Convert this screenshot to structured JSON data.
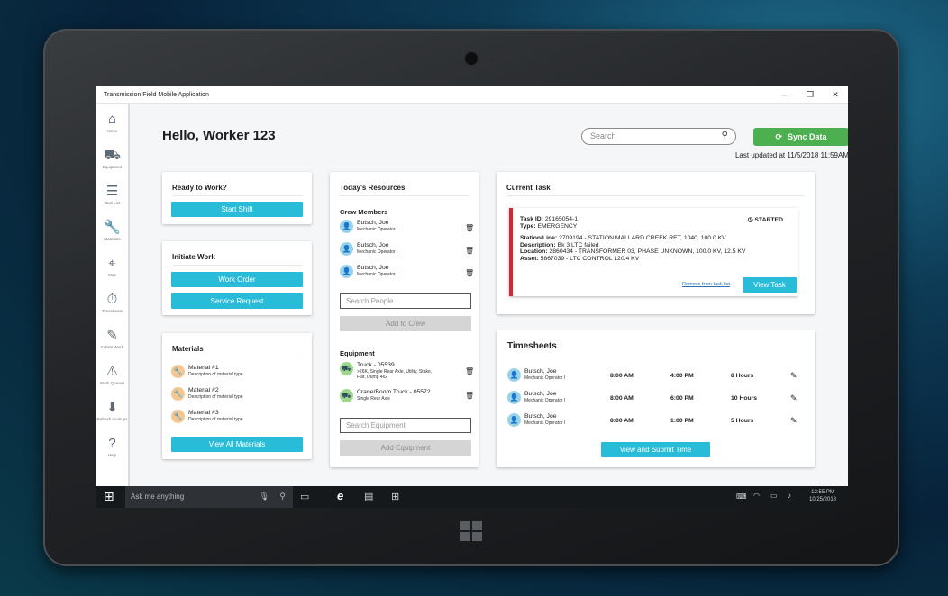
{
  "window": {
    "title": "Transmission Field Mobile Application"
  },
  "sidebar": {
    "items": [
      {
        "label": "Home",
        "icon": "home-icon",
        "glyph": "⌂"
      },
      {
        "label": "Equipment",
        "icon": "truck-icon",
        "glyph": "⛟"
      },
      {
        "label": "Task List",
        "icon": "task-list-icon",
        "glyph": "☰"
      },
      {
        "label": "Materials",
        "icon": "wrench-icon",
        "glyph": "🔧"
      },
      {
        "label": "Map",
        "icon": "map-pin-icon",
        "glyph": "⌖"
      },
      {
        "label": "Timesheets",
        "icon": "stopwatch-icon",
        "glyph": "⏱"
      },
      {
        "label": "Initiate Work",
        "icon": "pencil-icon",
        "glyph": "✎"
      },
      {
        "label": "Work Queues",
        "icon": "warning-icon",
        "glyph": "⚠"
      },
      {
        "label": "Refresh Lookups",
        "icon": "download-icon",
        "glyph": "⬇"
      },
      {
        "label": "Help",
        "icon": "help-icon",
        "glyph": "?"
      }
    ]
  },
  "header": {
    "greeting": "Hello, Worker 123",
    "search_placeholder": "Search",
    "sync_label": "Sync Data",
    "last_updated": "Last updated at 11/5/2018 11:59AM"
  },
  "ready": {
    "title": "Ready to Work?",
    "start_shift": "Start Shift"
  },
  "initiate": {
    "title": "Initiate Work",
    "work_order": "Work Order",
    "service_request": "Service Request"
  },
  "materials": {
    "title": "Materials",
    "items": [
      {
        "name": "Material #1",
        "desc": "Description of material type"
      },
      {
        "name": "Material #2",
        "desc": "Description of material type"
      },
      {
        "name": "Material #3",
        "desc": "Description of material type"
      }
    ],
    "view_all": "View All Materials"
  },
  "resources": {
    "title": "Today's Resources",
    "crew_title": "Crew Members",
    "crew": [
      {
        "name": "Butsch, Joe",
        "role": "Mechanic Operator I"
      },
      {
        "name": "Butsch, Joe",
        "role": "Mechanic Operator I"
      },
      {
        "name": "Butsch, Joe",
        "role": "Mechanic Operator I"
      }
    ],
    "search_people": "Search People",
    "add_to_crew": "Add to Crew",
    "equipment_title": "Equipment",
    "equipment": [
      {
        "name": "Truck - 05539",
        "desc1": ">26K, Single Rear Axle, Utility, Stake,",
        "desc2": "Flat, Dump 4x2"
      },
      {
        "name": "Crane/Boom Truck - 05572",
        "desc1": "Single Rear Axle",
        "desc2": ""
      }
    ],
    "search_equipment": "Search Equipment",
    "add_equipment": "Add Equipment"
  },
  "current_task": {
    "title": "Current Task",
    "task_id_label": "Task ID:",
    "task_id": "29165054-1",
    "type_label": "Type:",
    "type": "EMERGENCY",
    "status": "STARTED",
    "station_label": "Station/Line:",
    "station": "2709194 - STATION MALLARD CREEK RET, 1040, 100.0 KV",
    "description_label": "Description:",
    "description": "Bk 3 LTC failed",
    "location_label": "Location:",
    "location": "2860434 - TRANSFORMER 03, PHASE UNKNOWN, 100.0 KV, 12.5 KV",
    "asset_label": "Asset:",
    "asset": "5867039 - LTC CONTROL 120.4 KV",
    "remove_link": "Remove from task list",
    "view_task": "View Task"
  },
  "timesheets": {
    "title": "Timesheets",
    "rows": [
      {
        "name": "Butsch, Joe",
        "role": "Mechanic Operator I",
        "start": "8:00 AM",
        "end": "4:00 PM",
        "hours": "8 Hours"
      },
      {
        "name": "Butsch, Joe",
        "role": "Mechanic Operator I",
        "start": "8:00 AM",
        "end": "6:00 PM",
        "hours": "10 Hours"
      },
      {
        "name": "Butsch, Joe",
        "role": "Mechanic Operator I",
        "start": "8:00 AM",
        "end": "1:00 PM",
        "hours": "5 Hours"
      }
    ],
    "submit": "View and Submit Time"
  },
  "taskbar": {
    "search": "Ask me anything",
    "time": "12:55 PM",
    "date": "10/25/2018"
  },
  "colors": {
    "accent": "#28bcd8",
    "sync": "#4caf50",
    "alert": "#d9232e"
  }
}
